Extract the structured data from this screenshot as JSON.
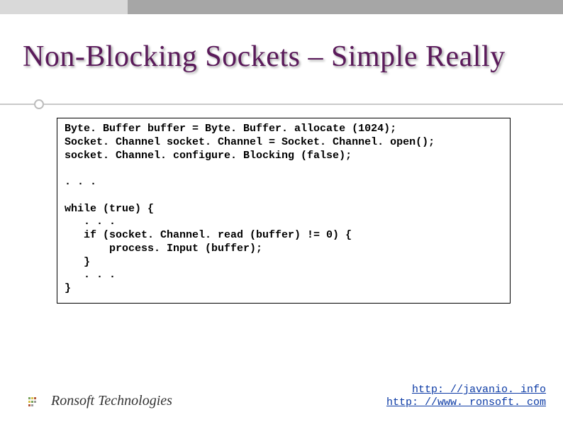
{
  "title": "Non-Blocking Sockets – Simple Really",
  "code": "Byte. Buffer buffer = Byte. Buffer. allocate (1024);\nSocket. Channel socket. Channel = Socket. Channel. open();\nsocket. Channel. configure. Blocking (false);\n\n. . .\n\nwhile (true) {\n   . . .\n   if (socket. Channel. read (buffer) != 0) {\n       process. Input (buffer);\n   }\n   . . .\n}",
  "footer": {
    "company": "Ronsoft Technologies",
    "link1": "http: //javanio. info",
    "link2": "http: //www. ronsoft. com"
  }
}
